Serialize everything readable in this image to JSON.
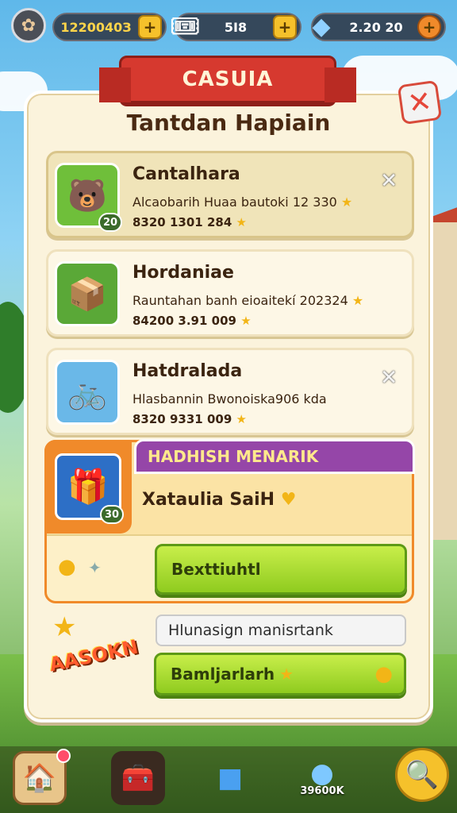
{
  "top_bar": {
    "coins": "1220040З",
    "tickets": "5I8",
    "gems": "2.20 20"
  },
  "panel": {
    "banner": "CASUIA",
    "title": "Tantdan Hapiain"
  },
  "cards": [
    {
      "title": "Cantalhara",
      "line1": "Alcaobarih Huaa bautoki 12 330",
      "line2": "8320 1301 284",
      "badge": "20",
      "icon": "bear-icon"
    },
    {
      "title": "Hordaniae",
      "line1": "Rauntahan banh eioaitekí 202324",
      "line2": "84200 3.91 009",
      "icon": "chest-icon"
    },
    {
      "title": "Hatdralada",
      "line1": "Hlasbannin Bwonoiska906 kda",
      "line2": "8320 9331 009",
      "icon": "bike-icon"
    }
  ],
  "offer": {
    "header": "HADHISH MENARIK",
    "subtitle": "Xataulia SaiH",
    "badge": "30",
    "button": "Bexttiuhtl"
  },
  "bottom_section": {
    "promo_text": "AASOKN",
    "input_value": "Hlunasign manisrtank",
    "button": "Bamljarlarh"
  },
  "bottom_nav": {
    "orb_label": "39600K"
  },
  "colors": {
    "panel": "#fbf3dc",
    "ribbon": "#d6392f",
    "offer_header": "#9546a8",
    "button_green": "#8fcb1f",
    "accent_gold": "#f5c12b"
  }
}
